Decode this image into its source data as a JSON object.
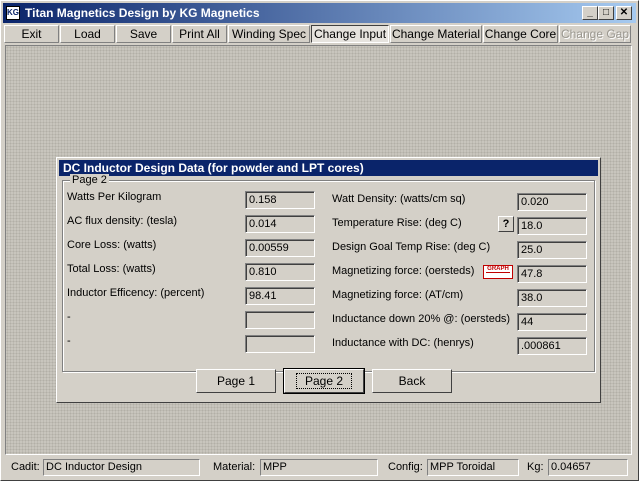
{
  "window": {
    "title": "Titan Magnetics Design by KG Magnetics",
    "icon_label": "KG",
    "minimize": "_",
    "maximize": "□",
    "close": "✕"
  },
  "menu": [
    "Exit",
    "Load",
    "Save",
    "Print All",
    "Winding Spec",
    "Change Input",
    "Change Material",
    "Change Core",
    "Change Gap"
  ],
  "dialog": {
    "title": "DC Inductor Design Data (for powder and LPT cores)",
    "group_label": "Page 2",
    "left": [
      {
        "label": "Watts Per Kilogram",
        "value": "0.158"
      },
      {
        "label": "AC flux density: (tesla)",
        "value": "0.014"
      },
      {
        "label": "Core Loss: (watts)",
        "value": "0.00559"
      },
      {
        "label": "Total Loss: (watts)",
        "value": "0.810"
      },
      {
        "label": "Inductor Efficency: (percent)",
        "value": "98.41"
      },
      {
        "label": "-",
        "value": ""
      },
      {
        "label": "-",
        "value": ""
      }
    ],
    "right": [
      {
        "label": "Watt Density: (watts/cm sq)",
        "value": "0.020"
      },
      {
        "label": "Temperature Rise: (deg C)",
        "value": "18.0"
      },
      {
        "label": "Design Goal Temp Rise: (deg C)",
        "value": "25.0"
      },
      {
        "label": "Magnetizing force: (oersteds)",
        "value": "47.8"
      },
      {
        "label": "Magnetizing force: (AT/cm)",
        "value": "38.0"
      },
      {
        "label": "Inductance down 20% @: (oersteds)",
        "value": "44"
      },
      {
        "label": "Inductance with DC: (henrys)",
        "value": ".000861"
      }
    ],
    "help_button": "?",
    "graph_button": "GRAPH",
    "buttons": {
      "page1": "Page 1",
      "page2": "Page 2",
      "back": "Back"
    }
  },
  "status": {
    "cadit_label": "Cadit:",
    "cadit_value": "DC Inductor Design",
    "material_label": "Material:",
    "material_value": "MPP",
    "config_label": "Config:",
    "config_value": "MPP Toroidal",
    "kg_label": "Kg:",
    "kg_value": "0.04657"
  }
}
